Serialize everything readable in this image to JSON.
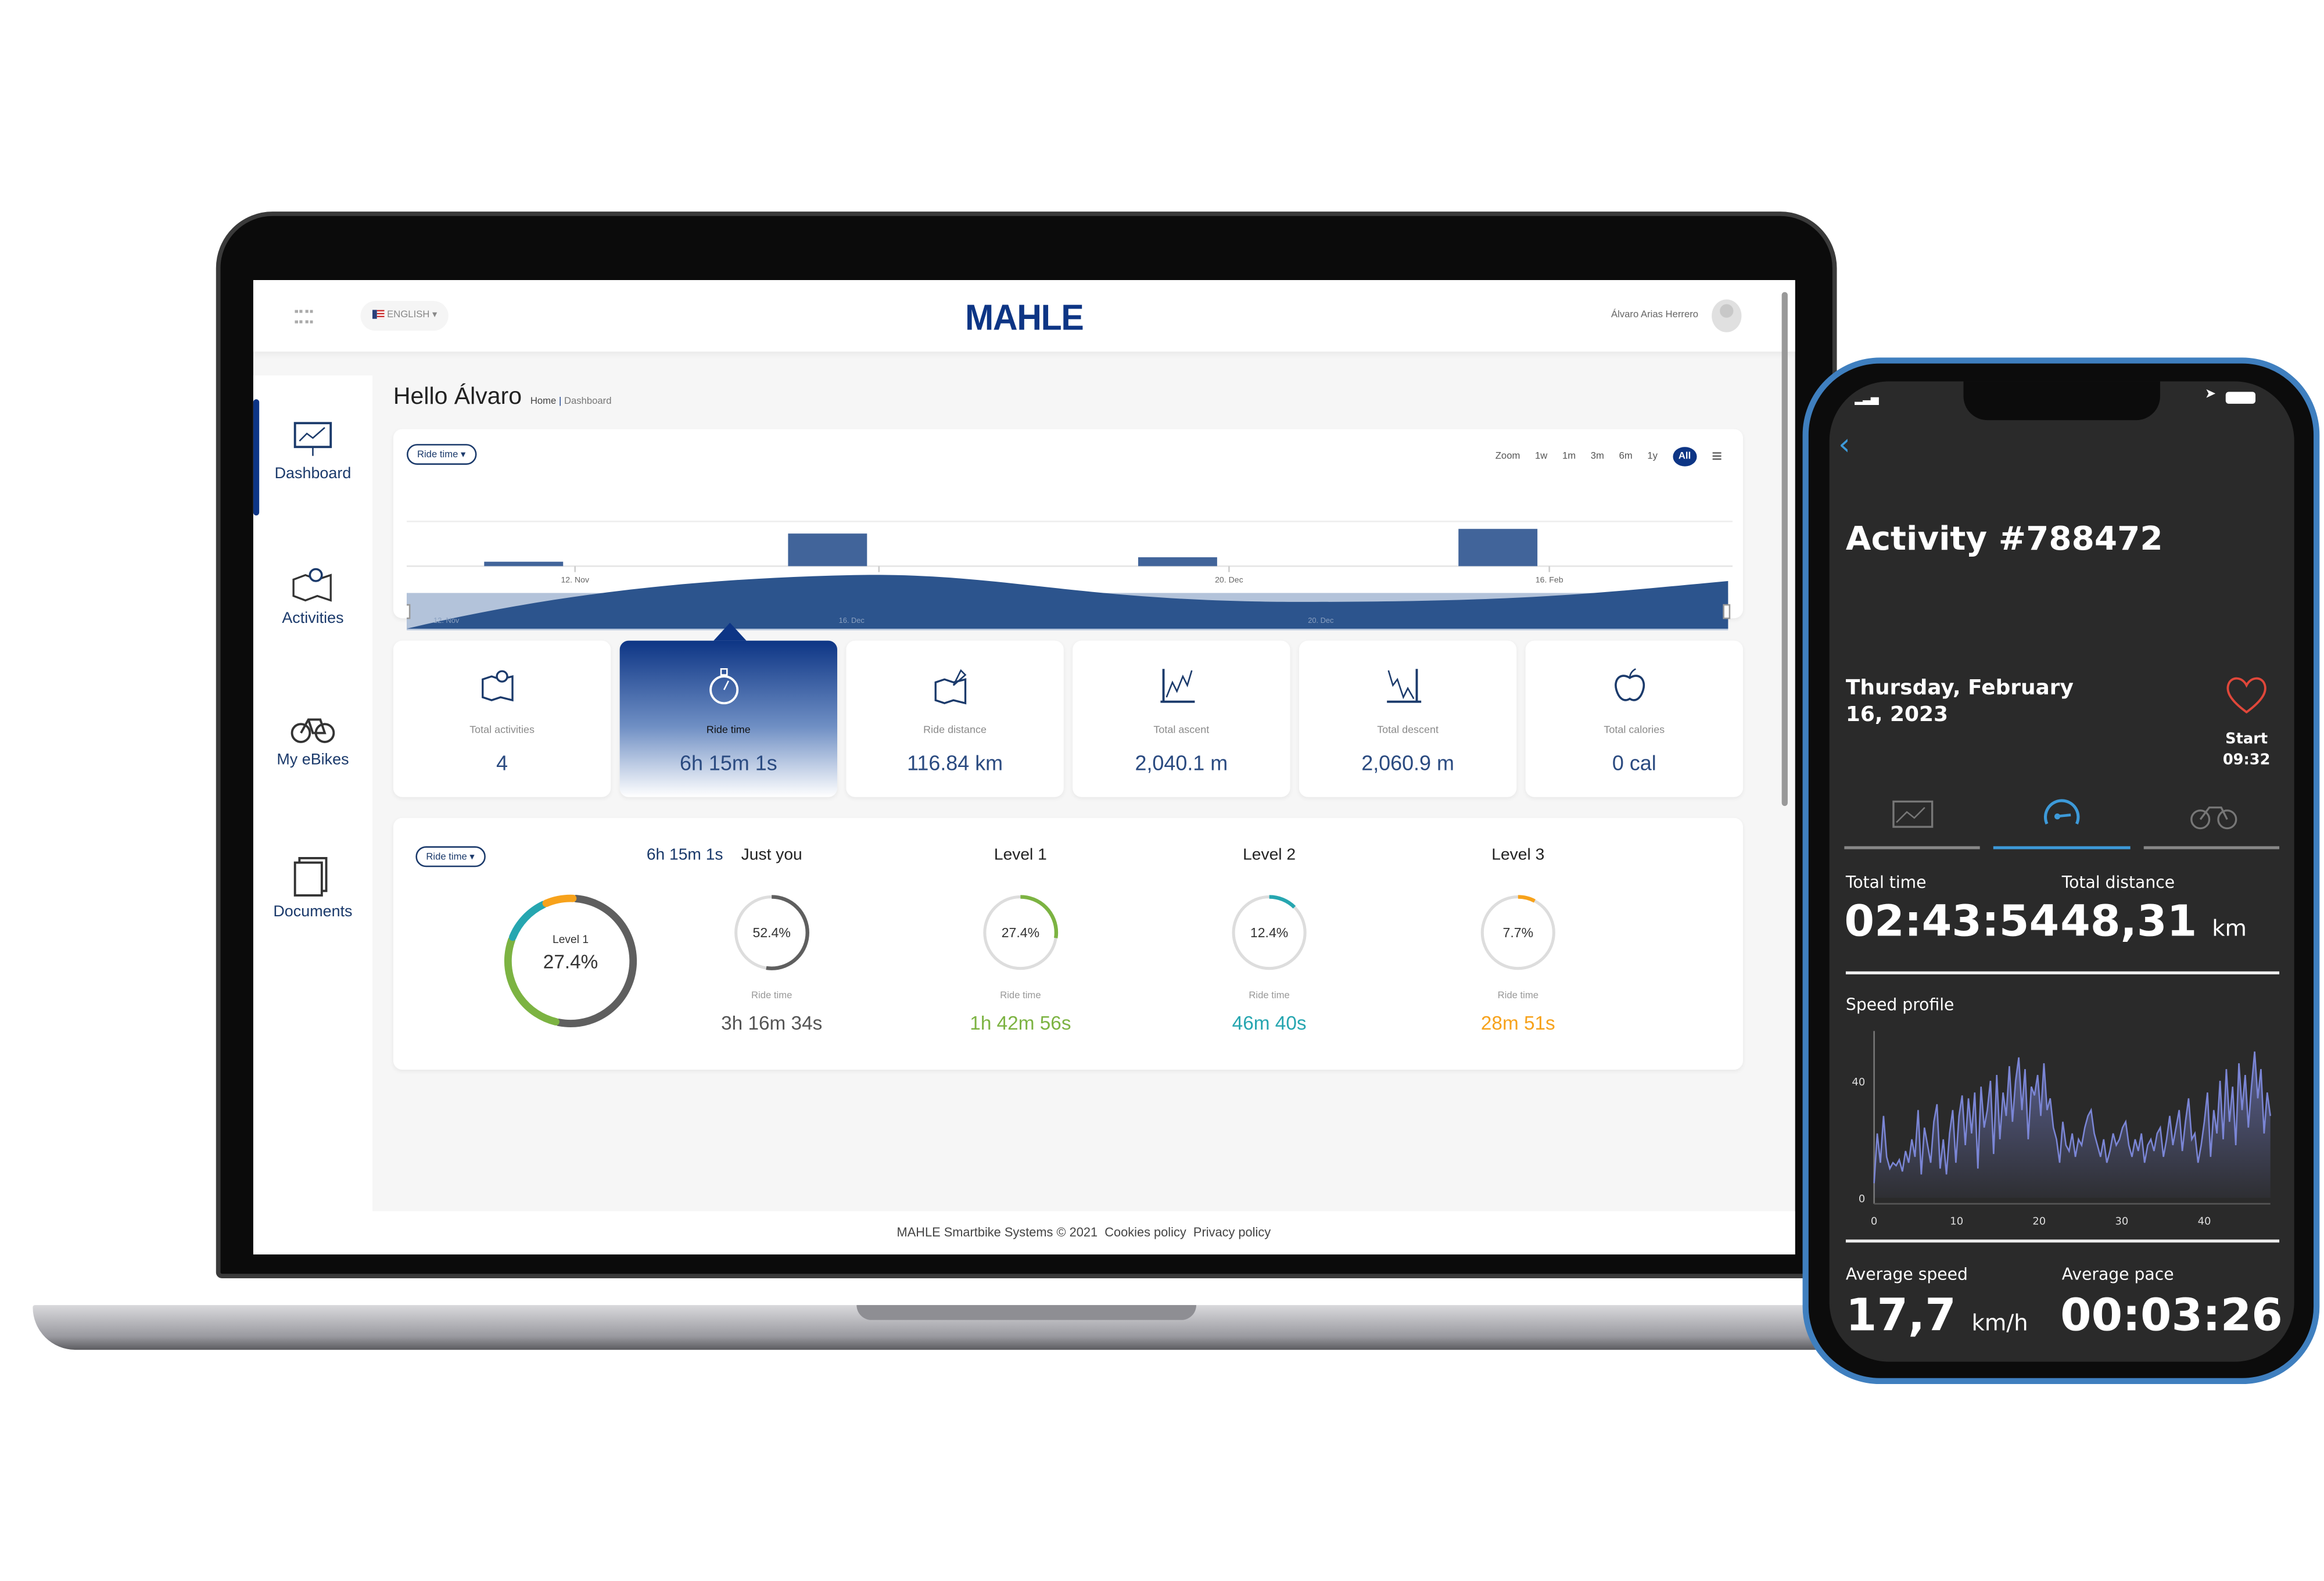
{
  "header": {
    "language": "ENGLISH",
    "logo": "MAHLE",
    "user_name": "Álvaro Arias Herrero"
  },
  "sidebar": {
    "items": [
      {
        "label": "Dashboard",
        "icon": "dashboard-chart-icon",
        "active": true
      },
      {
        "label": "Activities",
        "icon": "map-pin-icon"
      },
      {
        "label": "My eBikes",
        "icon": "bike-icon"
      },
      {
        "label": "Documents",
        "icon": "documents-icon"
      }
    ]
  },
  "page": {
    "greeting": "Hello Álvaro",
    "breadcrumb": [
      "Home",
      "Dashboard"
    ]
  },
  "timeline": {
    "metric": "Ride time ▾",
    "zoom_label": "Zoom",
    "zoom_options": [
      "1w",
      "1m",
      "3m",
      "6m",
      "1y",
      "All"
    ],
    "selected_zoom": "All",
    "chart_data": {
      "type": "bar",
      "categories": [
        "12. Nov",
        "16. Dec",
        "20. Dec",
        "16. Feb"
      ],
      "values": [
        20,
        147,
        40,
        168
      ],
      "navigator_labels": [
        "12. Nov",
        "16. Dec",
        "20. Dec"
      ]
    }
  },
  "stats": [
    {
      "label": "Total activities",
      "value": "4",
      "icon": "map-icon"
    },
    {
      "label": "Ride time",
      "value": "6h 15m 1s",
      "icon": "stopwatch-icon",
      "active": true
    },
    {
      "label": "Ride distance",
      "value": "116.84 km",
      "icon": "route-map-icon"
    },
    {
      "label": "Total ascent",
      "value": "2,040.1 m",
      "icon": "ascent-chart-icon"
    },
    {
      "label": "Total descent",
      "value": "2,060.9 m",
      "icon": "descent-chart-icon"
    },
    {
      "label": "Total calories",
      "value": "0 cal",
      "icon": "apple-icon"
    }
  ],
  "levels": {
    "metric": "Ride time ▾",
    "total": "6h 15m 1s",
    "donut_label": "Level 1",
    "donut_value": "27.4%",
    "items": [
      {
        "name": "Just you",
        "percent": 52.4,
        "percent_label": "52.4%",
        "sub": "Ride time",
        "value": "3h 16m 34s",
        "color": "#5f5f5f"
      },
      {
        "name": "Level 1",
        "percent": 27.4,
        "percent_label": "27.4%",
        "sub": "Ride time",
        "value": "1h 42m 56s",
        "color": "#7cb342"
      },
      {
        "name": "Level 2",
        "percent": 12.4,
        "percent_label": "12.4%",
        "sub": "Ride time",
        "value": "46m 40s",
        "color": "#26a6b0"
      },
      {
        "name": "Level 3",
        "percent": 7.7,
        "percent_label": "7.7%",
        "sub": "Ride time",
        "value": "28m 51s",
        "color": "#f7a21b"
      }
    ]
  },
  "footer": {
    "copyright": "MAHLE Smartbike Systems © 2021",
    "cookies": "Cookies policy",
    "privacy": "Privacy policy"
  },
  "phone": {
    "title": "Activity #788472",
    "date": "Thursday, February 16, 2023",
    "start_label": "Start",
    "start_time": "09:32",
    "tabs": [
      {
        "icon": "chart-icon"
      },
      {
        "icon": "speedometer-icon",
        "active": true
      },
      {
        "icon": "bike-icon"
      }
    ],
    "total_time_label": "Total time",
    "total_time": "02:43:54",
    "total_distance_label": "Total distance",
    "total_distance": "48,31",
    "distance_unit": "km",
    "speed_profile_label": "Speed profile",
    "chart_data": {
      "type": "area",
      "xlim": [
        0,
        48
      ],
      "ylim": [
        0,
        55
      ],
      "xticks": [
        "0",
        "10",
        "20",
        "30",
        "40"
      ],
      "yticks": [
        "0",
        "40"
      ],
      "values": [
        5,
        22,
        12,
        28,
        14,
        10,
        12,
        11,
        13,
        9,
        16,
        12,
        20,
        14,
        30,
        8,
        24,
        18,
        12,
        26,
        32,
        10,
        20,
        8,
        22,
        30,
        12,
        28,
        35,
        18,
        34,
        22,
        36,
        10,
        38,
        24,
        30,
        40,
        15,
        42,
        20,
        36,
        28,
        45,
        26,
        40,
        48,
        30,
        44,
        20,
        38,
        35,
        42,
        28,
        46,
        30,
        34,
        24,
        20,
        12,
        26,
        18,
        16,
        22,
        14,
        20,
        18,
        24,
        28,
        30,
        22,
        18,
        14,
        20,
        12,
        16,
        22,
        18,
        20,
        24,
        26,
        18,
        14,
        20,
        16,
        22,
        12,
        18,
        20,
        16,
        22,
        24,
        14,
        20,
        28,
        18,
        24,
        30,
        16,
        26,
        34,
        20,
        22,
        12,
        18,
        26,
        36,
        14,
        30,
        22,
        40,
        20,
        44,
        26,
        38,
        18,
        46,
        30,
        42,
        24,
        38,
        50,
        34,
        44,
        22,
        36,
        28
      ]
    },
    "avg_speed_label": "Average speed",
    "avg_speed": "17,7",
    "avg_speed_unit": "km/h",
    "avg_pace_label": "Average pace",
    "avg_pace": "00:03:26",
    "colors": {
      "accent": "#3d9ad9",
      "chart": "#7b86d6",
      "heart": "#e0473a"
    }
  }
}
